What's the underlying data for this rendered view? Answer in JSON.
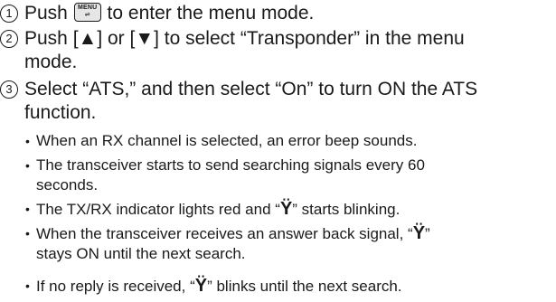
{
  "steps": [
    {
      "number": "1",
      "before": "Push ",
      "key": {
        "line1": "MENU",
        "line2": "⇌",
        "icon": "menu-key-icon"
      },
      "after": " to enter the menu mode."
    },
    {
      "number": "2",
      "line1": "Push [▲] or [▼] to select “Transponder” in the menu",
      "line2": "mode."
    },
    {
      "number": "3",
      "line1": "Select “ATS,” and then select “On” to turn ON the ATS",
      "line2": "function."
    }
  ],
  "bullets": [
    {
      "bullet": "•",
      "line1": "When an RX channel is selected, an error beep sounds."
    },
    {
      "bullet": "•",
      "line1": "The transceiver starts to send searching signals every 60",
      "line2": "seconds."
    },
    {
      "bullet": "•",
      "before": "The TX/RX indicator lights red and “",
      "symbol": "Ÿ",
      "after": "” starts blinking."
    },
    {
      "bullet": "•",
      "before": "When the transceiver receives an answer back signal, “",
      "symbol": "Ÿ",
      "after": "”",
      "line2": "stays ON until the next search."
    },
    {
      "bullet": "•",
      "before": "If no reply is received, “",
      "symbol": "Ÿ",
      "after": "” blinks until the next search."
    }
  ]
}
